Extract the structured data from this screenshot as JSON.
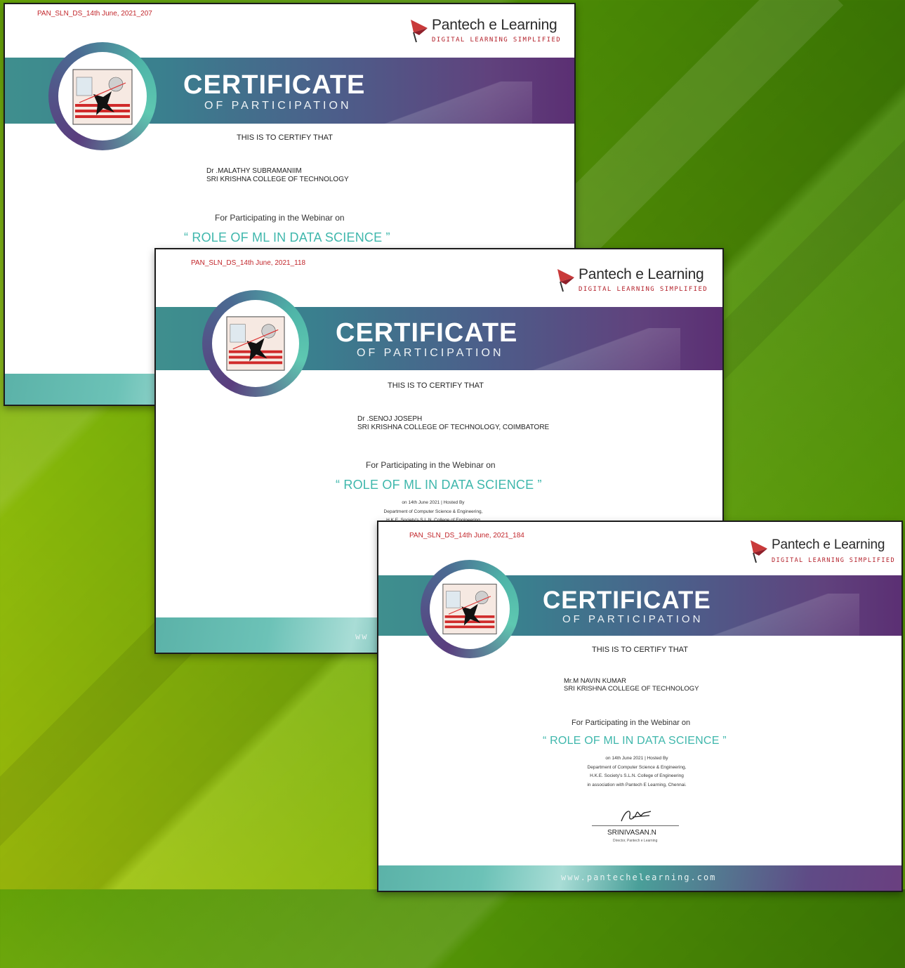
{
  "certificates": [
    {
      "id": "PAN_SLN_DS_14th June, 2021_207",
      "brand_name": "Pantech e Learning",
      "brand_tagline": "DIGITAL LEARNING SIMPLIFIED",
      "title": "CERTIFICATE",
      "subtitle": "OF PARTICIPATION",
      "certify_text": "THIS IS TO CERTIFY THAT",
      "recipient_name": "Dr .MALATHY SUBRAMANIIM",
      "recipient_org": "SRI KRISHNA COLLEGE OF TECHNOLOGY",
      "for_text": "For Participating in the Webinar on",
      "topic": "“ ROLE OF ML IN DATA SCIENCE ”"
    },
    {
      "id": "PAN_SLN_DS_14th June, 2021_118",
      "brand_name": "Pantech e Learning",
      "brand_tagline": "DIGITAL LEARNING SIMPLIFIED",
      "title": "CERTIFICATE",
      "subtitle": "OF PARTICIPATION",
      "certify_text": "THIS IS TO CERTIFY THAT",
      "recipient_name": "Dr .SENOJ JOSEPH",
      "recipient_org": "SRI KRISHNA COLLEGE OF TECHNOLOGY, COIMBATORE",
      "for_text": "For Participating in the Webinar on",
      "topic": "“ ROLE OF ML IN DATA SCIENCE ”",
      "details": [
        "on 14th June 2021  |  Hosted By",
        "Department of Computer Science & Engineering,",
        "H.K.E. Society's S.L.N. College of Engineering"
      ],
      "website_partial": "ww"
    },
    {
      "id": "PAN_SLN_DS_14th June, 2021_184",
      "brand_name": "Pantech e Learning",
      "brand_tagline": "DIGITAL LEARNING SIMPLIFIED",
      "title": "CERTIFICATE",
      "subtitle": "OF PARTICIPATION",
      "certify_text": "THIS IS TO CERTIFY THAT",
      "recipient_name": "Mr.M NAVIN KUMAR",
      "recipient_org": "SRI KRISHNA COLLEGE OF TECHNOLOGY",
      "for_text": "For Participating in the Webinar on",
      "topic": "“ ROLE OF ML IN DATA SCIENCE ”",
      "details": [
        "on 14th June 2021  |  Hosted By",
        "Department of Computer Science & Engineering,",
        "H.K.E. Society's S.L.N. College of Engineering",
        "in association with  Pantech E Learning, Chennai."
      ],
      "signatory": "SRINIVASAN.N",
      "signatory_role": "Director, Pantech e Learning",
      "website": "www.pantechelearning.com"
    }
  ],
  "colors": {
    "id_red": "#c2262b",
    "topic_teal": "#3fb7ac",
    "band_start": "#3f8f8e",
    "band_end": "#5b2f73",
    "background_green": "#6aa808"
  },
  "icons": [
    "pantech-logo-icon",
    "college-emblem-icon",
    "signature-icon"
  ]
}
